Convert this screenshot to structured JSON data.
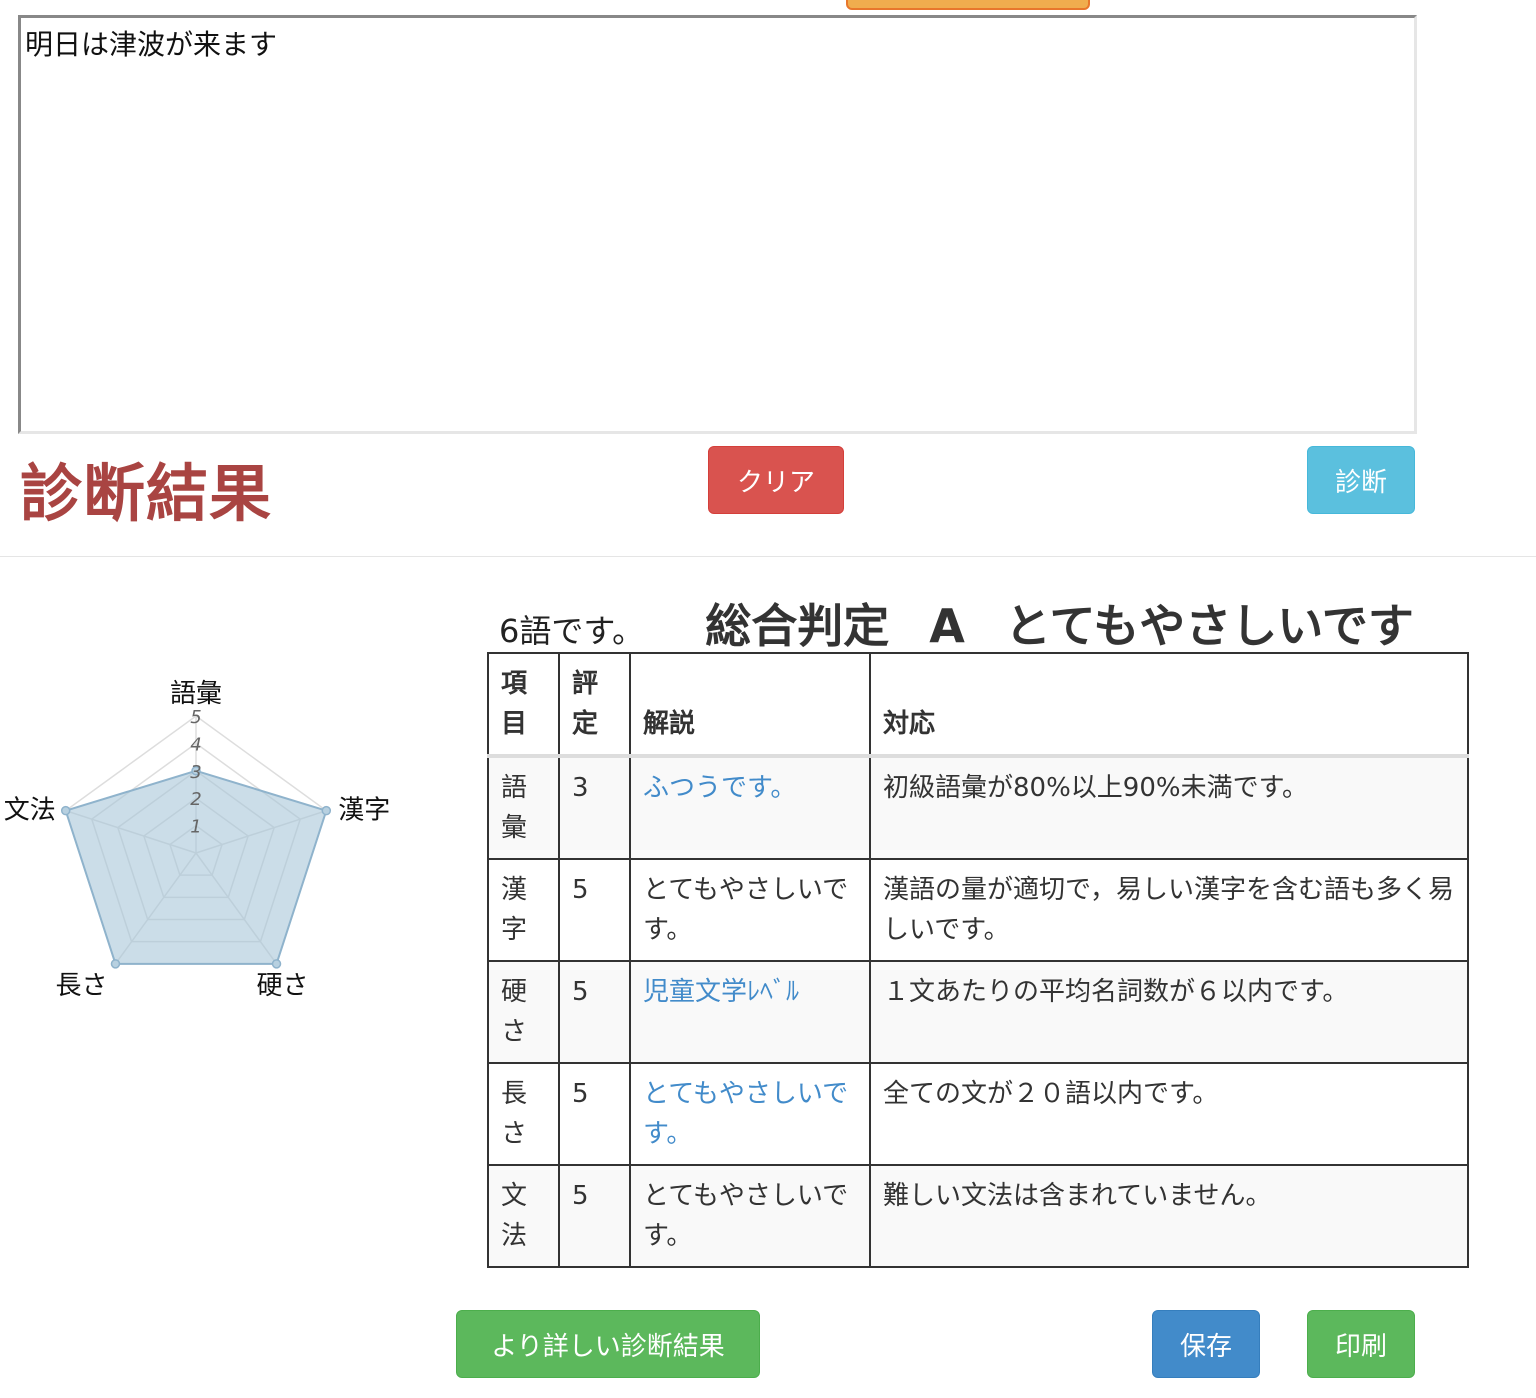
{
  "input": {
    "text": "明日は津波が来ます"
  },
  "result": {
    "heading": "診断結果",
    "word_count": "6語です。",
    "overall_label": "総合判定",
    "overall_grade": "A",
    "overall_text": "とてもやさしいです"
  },
  "buttons": {
    "clear": "クリア",
    "diagnose": "診断",
    "detail": "より詳しい診断結果",
    "save": "保存",
    "print": "印刷"
  },
  "table": {
    "headers": [
      "項目",
      "評定",
      "解説",
      "対応"
    ],
    "rows": [
      {
        "item": "語彙",
        "score": "3",
        "comment": "ふつうです。",
        "comment_is_link": true,
        "response": "初級語彙が80%以上90%未満です。"
      },
      {
        "item": "漢字",
        "score": "5",
        "comment": "とてもやさしいです。",
        "comment_is_link": false,
        "response": "漢語の量が適切で，易しい漢字を含む語も多く易しいです。"
      },
      {
        "item": "硬さ",
        "score": "5",
        "comment": "児童文学ﾚﾍﾞﾙ",
        "comment_is_link": true,
        "response": "１文あたりの平均名詞数が６以内です。"
      },
      {
        "item": "長さ",
        "score": "5",
        "comment": "とてもやさしいです。",
        "comment_is_link": true,
        "response": "全ての文が２０語以内です。"
      },
      {
        "item": "文法",
        "score": "5",
        "comment": "とてもやさしいです。",
        "comment_is_link": false,
        "response": "難しい文法は含まれていません。"
      }
    ]
  },
  "colors": {
    "heading_red": "#a94442",
    "link_blue": "#428bca",
    "radar_fill": "#a9c6d9",
    "radar_stroke": "#8fb3cc"
  },
  "chart_data": {
    "type": "radar",
    "axes": [
      "語彙",
      "漢字",
      "硬さ",
      "長さ",
      "文法"
    ],
    "values": [
      3,
      5,
      5,
      5,
      5
    ],
    "scale": {
      "min": 0,
      "max": 5,
      "ticks": [
        "1",
        "2",
        "3",
        "4",
        "5"
      ]
    }
  }
}
